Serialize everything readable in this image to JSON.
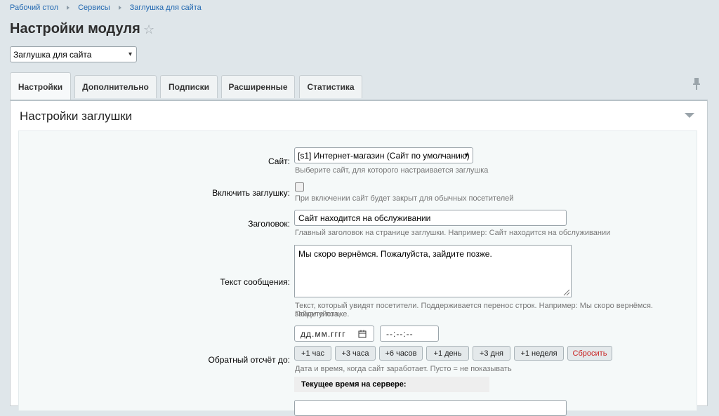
{
  "breadcrumb": [
    "Рабочий стол",
    "Сервисы",
    "Заглушка для сайта"
  ],
  "page_title": "Настройки модуля",
  "module_select": "Заглушка для сайта",
  "tabs": [
    "Настройки",
    "Дополнительно",
    "Подписки",
    "Расширенные",
    "Статистика"
  ],
  "active_tab": 0,
  "section_title": "Настройки заглушки",
  "form": {
    "site": {
      "label": "Сайт:",
      "value": "[s1] Интернет-магазин (Сайт по умолчанию)",
      "hint": "Выберите сайт, для которого настраивается заглушка"
    },
    "enable": {
      "label": "Включить заглушку:",
      "checked": false,
      "hint": "При включении сайт будет закрыт для обычных посетителей"
    },
    "heading": {
      "label": "Заголовок:",
      "value": "Сайт находится на обслуживании",
      "hint": "Главный заголовок на странице заглушки. Например: Сайт находится на обслуживании"
    },
    "message": {
      "label": "Текст сообщения:",
      "value": "Мы скоро вернёмся. Пожалуйста, зайдите позже.",
      "hint_line1": "Текст, который увидят посетители. Поддерживается перенос строк. Например: Мы скоро вернёмся. Пожалуйста,",
      "hint_line2": "зайдите позже."
    },
    "countdown": {
      "label": "Обратный отсчёт до:",
      "date_placeholder": "дд.мм.гггг",
      "time_placeholder": "--:--:--",
      "buttons": [
        "+1 час",
        "+3 часа",
        "+6 часов",
        "+1 день",
        "+3 дня",
        "+1 неделя"
      ],
      "reset_label": "Сбросить",
      "hint": "Дата и время, когда сайт заработает. Пусто = не показывать"
    },
    "server_time": {
      "label": "Текущее время на сервере:"
    }
  }
}
